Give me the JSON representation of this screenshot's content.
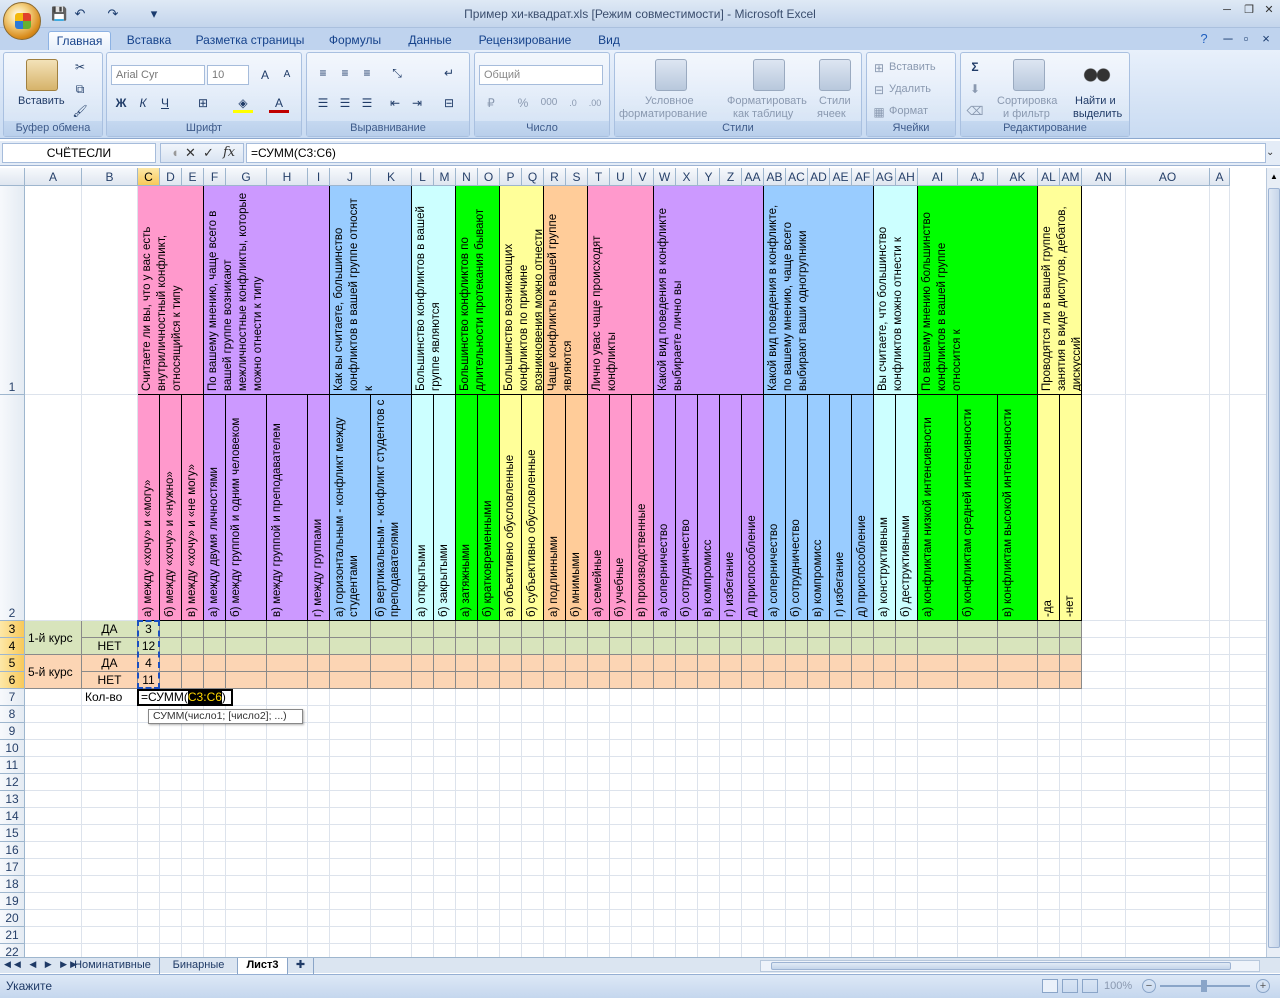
{
  "window": {
    "title": "Пример хи-квадрат.xls  [Режим совместимости] - Microsoft Excel"
  },
  "ribbon": {
    "tabs": [
      "Главная",
      "Вставка",
      "Разметка страницы",
      "Формулы",
      "Данные",
      "Рецензирование",
      "Вид"
    ],
    "clipboard": {
      "paste": "Вставить",
      "label": "Буфер обмена"
    },
    "font": {
      "name": "Arial Cyr",
      "size": "10",
      "label": "Шрифт"
    },
    "alignment": {
      "label": "Выравнивание"
    },
    "number": {
      "format": "Общий",
      "label": "Число",
      "percent": "%",
      "thousands": "000"
    },
    "styles": {
      "conditional": [
        "Условное",
        "форматирование"
      ],
      "as_table": [
        "Форматировать",
        "как таблицу"
      ],
      "cell_styles": [
        "Стили",
        "ячеек"
      ],
      "label": "Стили"
    },
    "cells": {
      "insert": "Вставить",
      "delete": "Удалить",
      "format": "Формат",
      "label": "Ячейки"
    },
    "editing": {
      "sum": "Σ",
      "sort": [
        "Сортировка",
        "и фильтр"
      ],
      "find": [
        "Найти и",
        "выделить"
      ],
      "label": "Редактирование"
    }
  },
  "formula_bar": {
    "name_box": "СЧЁТЕСЛИ",
    "fx": "fx",
    "formula": "=СУММ(C3:C6)"
  },
  "columns": [
    "A",
    "B",
    "C",
    "D",
    "E",
    "F",
    "G",
    "H",
    "I",
    "J",
    "K",
    "L",
    "M",
    "N",
    "O",
    "P",
    "Q",
    "R",
    "S",
    "T",
    "U",
    "V",
    "W",
    "X",
    "Y",
    "Z",
    "AA",
    "AB",
    "AC",
    "AD",
    "AE",
    "AF",
    "AG",
    "AH",
    "AI",
    "AJ",
    "AK",
    "AL",
    "AM",
    "AN",
    "AO",
    "A"
  ],
  "rows": [
    "1",
    "2",
    "3",
    "4",
    "5",
    "6",
    "7",
    "8",
    "9",
    "10",
    "11",
    "12",
    "13",
    "14",
    "15",
    "16",
    "17",
    "18",
    "19",
    "20",
    "21",
    "22"
  ],
  "questions": [
    {
      "text": "Считаете ли вы, что у вас есть внутриличностный конфликт, относящийся к типу",
      "color": "#ff99cc"
    },
    {
      "text": "По вашему мнению, чаще всего в вашей группе возникают межличностные конфликты, которые можно отнести к типу",
      "color": "#cc99ff"
    },
    {
      "text": "Как вы считаете, большинство конфликтов в вашей группе относят к",
      "color": "#99ccff"
    },
    {
      "text": "Большинство конфликтов в вашей группе являются",
      "color": "#ccffff"
    },
    {
      "text": "Большинство конфликтов по длительности протекания бывают",
      "color": "#00ff00"
    },
    {
      "text": "Большинство возникающих конфликтов по причине возникновения можно отнести",
      "color": "#ffff99"
    },
    {
      "text": "Чаще конфликты в вашей группе являются",
      "color": "#ffcc99"
    },
    {
      "text": "Лично увас чаще происходят конфликты",
      "color": "#ff99cc"
    },
    {
      "text": "Какой вид поведения в конфликте выбираете лично вы",
      "color": "#cc99ff"
    },
    {
      "text": "Какой вид поведения в конфликте, по вашему мнению, чаще всего выбирают ваши одногрупники",
      "color": "#99ccff"
    },
    {
      "text": "Вы считаете, что большинство конфликтов можно отнести к",
      "color": "#ccffff"
    },
    {
      "text": "По вашему мнению большинство конфликтов в вашей группе относится к",
      "color": "#00ff00"
    },
    {
      "text": "Проводятся ли в вашей группе занятия в виде диспутов, дебатов, дискуссий",
      "color": "#ffff99"
    }
  ],
  "options": [
    "а) между «хочу» и «могу»",
    "б) между «хочу» и «нужно»",
    "в) между «хочу» и «не могу»",
    "а) между двумя личностями",
    "б) между группой и одним человеком",
    "в) между группой и преподавателем",
    "г) между группами",
    "а) горизонтальным - конфликт между студентами",
    "б) вертикальным - конфликт студентов с преподавателями",
    "а) открытыми",
    "б) закрытыми",
    "а) затяжными",
    "б) кратковременными",
    "а) объективно обусловленные",
    "б) субъективно обусловленные",
    "а) подлинными",
    "б) мнимыми",
    "а) семейные",
    "б) учебные",
    "в) производственные",
    "а) соперничество",
    "б) сотрудничество",
    "в) компромисс",
    "г) избегание",
    "д) приспособление",
    "а) соперничество",
    "б) сотрудничество",
    "в) компромисс",
    "г) избегание",
    "д) приспособление",
    "а) конструктивным",
    "б) деструктивными",
    "а) конфликтам низкой интенсивности",
    "б) конфликтам средней интенсивности",
    "в) конфликтам высокой интенсивности",
    "-да",
    "-нет"
  ],
  "table": {
    "groups": [
      "1-й курс",
      "5-й курс"
    ],
    "answers": [
      "ДА",
      "НЕТ",
      "ДА",
      "НЕТ"
    ],
    "values": [
      "3",
      "12",
      "4",
      "11"
    ],
    "total_label": "Кол-во",
    "editing_text": "=СУММ(",
    "editing_ref": "C3:C6",
    "editing_close": ")",
    "tooltip": "СУММ(число1; [число2]; ...)"
  },
  "sheet_tabs": [
    "Номинативные",
    "Бинарные",
    "Лист3"
  ],
  "status": {
    "mode": "Укажите",
    "zoom": "100%"
  }
}
